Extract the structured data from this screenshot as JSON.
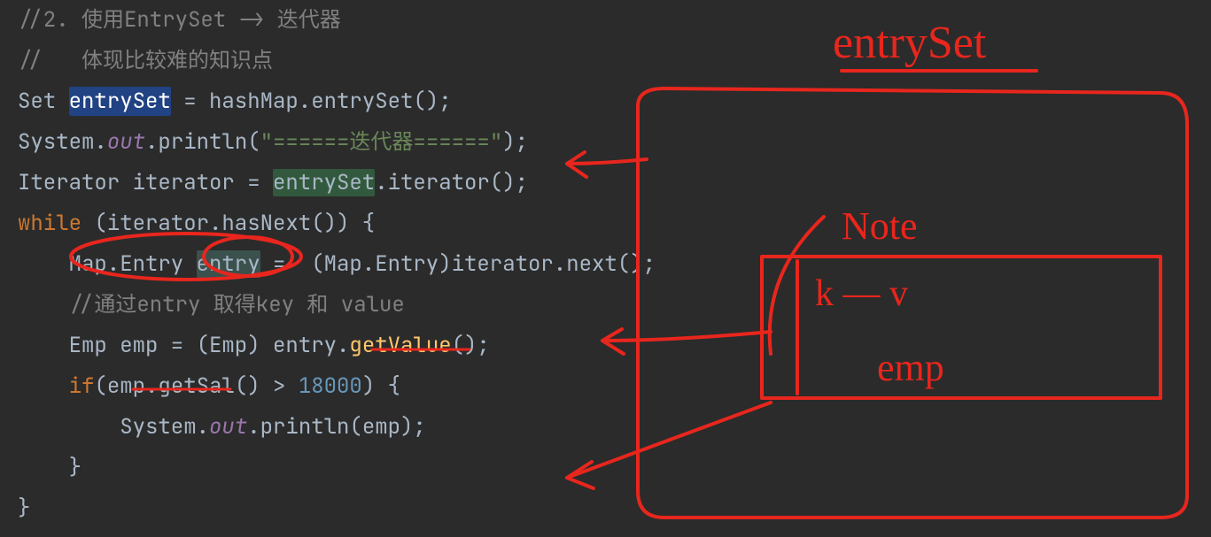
{
  "code": {
    "l1a": "//2. 使用EntrySet -> 迭代器",
    "l2a": "//   体现比较难的知识点",
    "l3_set": "Set ",
    "l3_entry": "entrySet",
    "l3_rest1": " = hashMap.",
    "l3_meth": "entrySet",
    "l3_rest2": "();",
    "l4_sys": "System.",
    "l4_out": "out",
    "l4_print": ".println(",
    "l4_str": "\"======迭代器======\"",
    "l4_end": ");",
    "l5_iter": "Iterator iterator = ",
    "l5_entry": "entrySet",
    "l5_rest": ".iterator();",
    "l6_while": "while",
    "l6_rest": " (iterator.hasNext()) {",
    "l7_indent": "    ",
    "l7_map": "Map.Entry ",
    "l7_entry": "entry",
    "l7_mid": " =  (Map.Entry)iterator.next();",
    "l8_indent": "    ",
    "l8_comment": "//通过entry 取得key 和 value",
    "l9_indent": "    ",
    "l9_a": "Emp emp = (Emp) entry.",
    "l9_meth": "getValue",
    "l9_end": "();",
    "l10_indent": "    ",
    "l10_if": "if",
    "l10_a": "(emp.",
    "l10_meth": "getSal",
    "l10_b": "() > ",
    "l10_num": "18000",
    "l10_c": ") {",
    "l11_indent": "        ",
    "l11_sys": "System.",
    "l11_out": "out",
    "l11_rest": ".println(emp);",
    "l12_indent": "    ",
    "l12_brace": "}",
    "l13_brace": "}"
  },
  "annotations": {
    "title": "entrySet",
    "node": "Note",
    "kv": "k — v",
    "emp": "emp"
  },
  "colors": {
    "annotation": "#e8261d"
  }
}
